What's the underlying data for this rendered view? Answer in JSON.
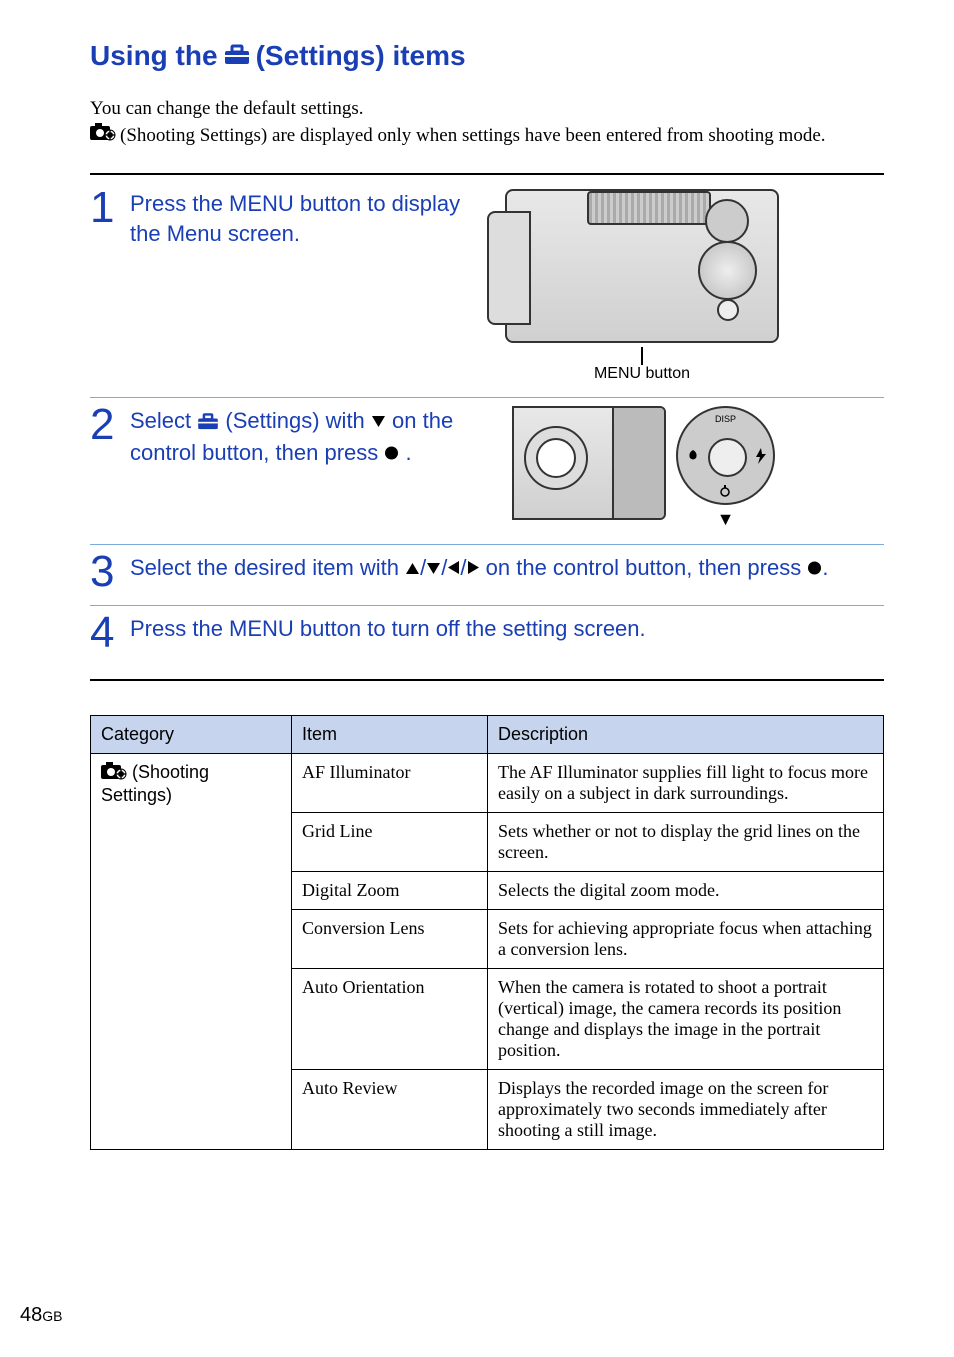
{
  "title": {
    "before": "Using the",
    "after": "(Settings) items"
  },
  "intro": {
    "line1": "You can change the default settings.",
    "line2_icon_label": "(Shooting Settings)",
    "line2_rest": "are displayed only when settings have been entered from shooting mode."
  },
  "steps": [
    {
      "num": "1",
      "text_full": "Press the MENU button to display the Menu screen.",
      "callout": "MENU button"
    },
    {
      "num": "2",
      "text_before": "Select",
      "text_mid1": "(Settings) with",
      "text_mid2": "on the control button, then press",
      "text_end": ".",
      "ctrl_disp": "DISP"
    },
    {
      "num": "3",
      "text_before": "Select the desired item with",
      "text_after": "on the control button, then press",
      "text_end": "."
    },
    {
      "num": "4",
      "text_full": "Press the MENU button to turn off the setting screen."
    }
  ],
  "table": {
    "headers": [
      "Category",
      "Item",
      "Description"
    ],
    "category_label": "(Shooting Settings)",
    "rows": [
      {
        "item": "AF Illuminator",
        "desc": "The AF Illuminator supplies fill light to focus more easily on a subject in dark surroundings."
      },
      {
        "item": "Grid Line",
        "desc": "Sets whether or not to display the grid lines on the screen."
      },
      {
        "item": "Digital Zoom",
        "desc": "Selects the digital zoom mode."
      },
      {
        "item": "Conversion Lens",
        "desc": "Sets for achieving appropriate focus when attaching a conversion lens."
      },
      {
        "item": "Auto Orientation",
        "desc": "When the camera is rotated to shoot a portrait (vertical) image, the camera records its position change and displays the image in the portrait position."
      },
      {
        "item": "Auto Review",
        "desc": "Displays the recorded image on the screen for approximately two seconds immediately after shooting a still image."
      }
    ]
  },
  "page": {
    "num": "48",
    "suffix": "GB"
  }
}
